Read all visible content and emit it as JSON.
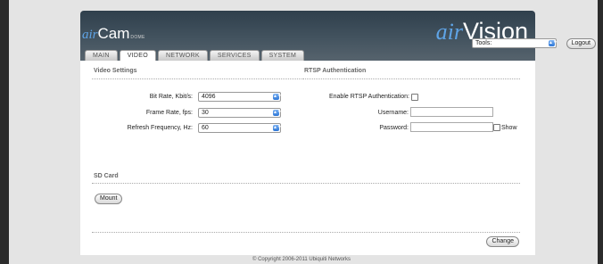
{
  "brand": {
    "left_prefix": "air",
    "left_name": "Cam",
    "left_suffix": "DOME",
    "right_prefix": "air",
    "right_name": "Vision"
  },
  "tabs": [
    {
      "label": "MAIN",
      "active": false
    },
    {
      "label": "VIDEO",
      "active": true
    },
    {
      "label": "NETWORK",
      "active": false
    },
    {
      "label": "SERVICES",
      "active": false
    },
    {
      "label": "SYSTEM",
      "active": false
    }
  ],
  "toolbar": {
    "tools_label": "Tools:",
    "tools_value": "",
    "logout_label": "Logout"
  },
  "video_settings": {
    "title": "Video Settings",
    "bit_rate_label": "Bit Rate, Kbit/s:",
    "bit_rate_value": "4096",
    "frame_rate_label": "Frame Rate, fps:",
    "frame_rate_value": "30",
    "refresh_label": "Refresh Frequency, Hz:",
    "refresh_value": "60"
  },
  "rtsp": {
    "title": "RTSP Authentication",
    "enable_label": "Enable RTSP Authentication:",
    "enable_checked": false,
    "username_label": "Username:",
    "username_value": "",
    "password_label": "Password:",
    "password_value": "",
    "show_label": "Show"
  },
  "sd_card": {
    "title": "SD Card",
    "mount_label": "Mount"
  },
  "actions": {
    "change_label": "Change"
  },
  "footer": {
    "copyright": "© Copyright 2006-2011 Ubiquiti Networks"
  },
  "colors": {
    "header_dark": "#2f3f4c",
    "brand_blue": "#5fa4e6",
    "select_arrow_blue": "#2c76d6"
  }
}
